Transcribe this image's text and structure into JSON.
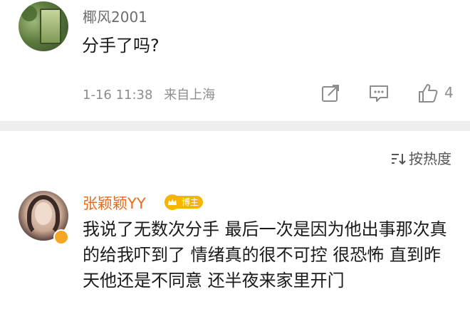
{
  "top_comment": {
    "username": "椰风2001",
    "text": "分手了吗?",
    "timestamp": "1-16 11:38",
    "location": "来自上海",
    "like_count": "4",
    "icons": [
      "forward-icon",
      "comment-icon",
      "like-icon"
    ]
  },
  "sort": {
    "label": "按热度",
    "icon": "sort-icon"
  },
  "reply": {
    "username": "张颖颖YY",
    "badge": "博主",
    "badge_color": "#f7b500",
    "name_color": "#e86c1e",
    "text": "我说了无数次分手 最后一次是因为他出事那次真的给我吓到了 情绪真的很不可控 很恐怖  直到昨天他还是不同意 还半夜来家里开门"
  }
}
